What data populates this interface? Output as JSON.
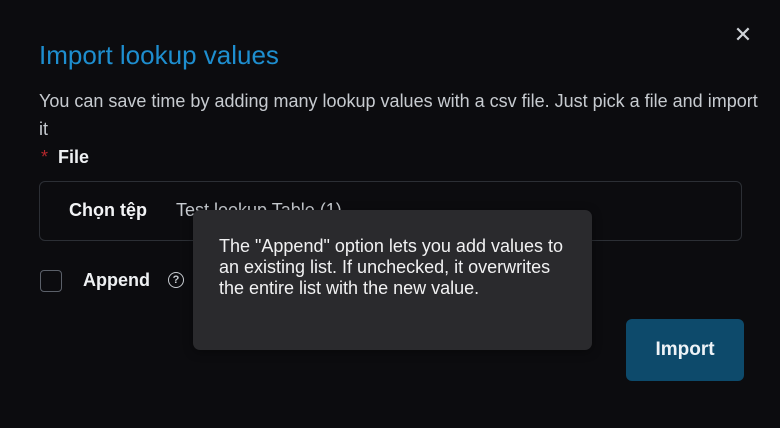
{
  "dialog": {
    "title": "Import lookup values",
    "description": "You can save time by adding many lookup values with a csv file. Just pick a file and import it",
    "close_icon": "close-icon",
    "close_glyph": "✕"
  },
  "file": {
    "required_mark": "*",
    "label": "File",
    "choose_button": "Chọn tệp",
    "file_name": "Test lookup Table (1)"
  },
  "append": {
    "label": "Append",
    "help_icon": "help-icon",
    "help_glyph": "?",
    "checked": false
  },
  "tooltip": {
    "text": "The \"Append\" option lets you add values to an existing list. If unchecked, it overwrites the entire list with the new value."
  },
  "actions": {
    "import_label": "Import"
  },
  "colors": {
    "title": "#1e8ecf",
    "primary_button": "#0d4a6b",
    "required": "#b4272c",
    "background": "#0c0c0f",
    "tooltip_background": "#2a2a2d"
  }
}
